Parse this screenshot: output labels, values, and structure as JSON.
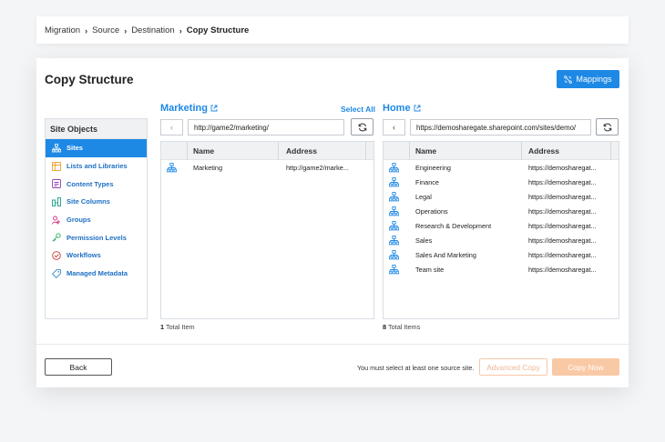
{
  "breadcrumb": {
    "items": [
      "Migration",
      "Source",
      "Destination"
    ],
    "current": "Copy Structure"
  },
  "page": {
    "title": "Copy Structure",
    "mappings_label": "Mappings"
  },
  "site_objects": {
    "title": "Site Objects",
    "items": [
      {
        "label": "Sites",
        "icon": "sites-icon",
        "active": true
      },
      {
        "label": "Lists and Libraries",
        "icon": "list-icon"
      },
      {
        "label": "Content Types",
        "icon": "content-type-icon"
      },
      {
        "label": "Site Columns",
        "icon": "columns-icon"
      },
      {
        "label": "Groups",
        "icon": "groups-icon"
      },
      {
        "label": "Permission Levels",
        "icon": "key-icon"
      },
      {
        "label": "Workflows",
        "icon": "workflow-icon"
      },
      {
        "label": "Managed Metadata",
        "icon": "tag-icon"
      }
    ]
  },
  "source": {
    "title": "Marketing",
    "select_all": "Select All",
    "url": "http://game2/marketing/",
    "col_name": "Name",
    "col_address": "Address",
    "rows": [
      {
        "name": "Marketing",
        "address": "http://game2/marke..."
      }
    ],
    "total_count": "1",
    "total_label": "Total Item"
  },
  "destination": {
    "title": "Home",
    "url": "https://demosharegate.sharepoint.com/sites/demo/",
    "col_name": "Name",
    "col_address": "Address",
    "rows": [
      {
        "name": "Engineering",
        "address": "https://demosharegat..."
      },
      {
        "name": "Finance",
        "address": "https://demosharegat..."
      },
      {
        "name": "Legal",
        "address": "https://demosharegat..."
      },
      {
        "name": "Operations",
        "address": "https://demosharegat..."
      },
      {
        "name": "Research & Development",
        "address": "https://demosharegat..."
      },
      {
        "name": "Sales",
        "address": "https://demosharegat..."
      },
      {
        "name": "Sales And Marketing",
        "address": "https://demosharegat..."
      },
      {
        "name": "Team site",
        "address": "https://demosharegat..."
      }
    ],
    "total_count": "8",
    "total_label": "Total Items"
  },
  "footer": {
    "back_label": "Back",
    "message": "You must select at least one source site.",
    "advanced_copy_label": "Advanced Copy",
    "copy_now_label": "Copy Now"
  },
  "colors": {
    "accent": "#1e88e5",
    "orange_disabled": "#f9c9a6"
  }
}
